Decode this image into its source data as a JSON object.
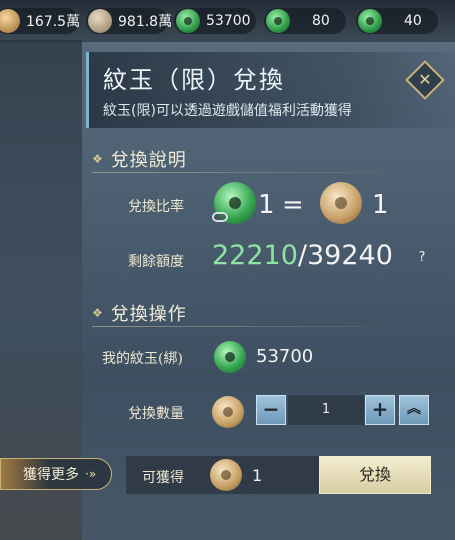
{
  "currencies": [
    {
      "icon": "gold-coin-icon",
      "value": "167.5萬"
    },
    {
      "icon": "silver-coin-icon",
      "value": "981.8萬"
    },
    {
      "icon": "jade-bound-icon",
      "value": "53700"
    },
    {
      "icon": "jade-add-icon",
      "value": "80"
    },
    {
      "icon": "jade-add-icon",
      "value": "40"
    }
  ],
  "header": {
    "title": "紋玉（限）兌換",
    "subtitle": "紋玉(限)可以透過遊戲儲值福利活動獲得"
  },
  "section_info": {
    "title": "兌換說明",
    "ratio_label": "兌換比率",
    "ratio_left": "1",
    "ratio_eq": "=",
    "ratio_right": "1",
    "remain_label": "剩餘額度",
    "remain_current": "22210",
    "remain_total": "/39240",
    "help": "?"
  },
  "section_op": {
    "title": "兌換操作",
    "my_jade_label": "我的紋玉(綁)",
    "my_jade_value": "53700",
    "qty_label": "兌換數量",
    "minus": "−",
    "qty_value": "1",
    "plus": "+",
    "max": "︽"
  },
  "footer": {
    "get_more": "獲得更多",
    "get_more_arrow": "·»",
    "obtain_label": "可獲得",
    "obtain_value": "1",
    "exchange_btn": "兌換"
  },
  "colors": {
    "accent_green": "#8fe3a0",
    "button_blue": "#8fb4cf",
    "confirm_cream": "#efe6c6"
  }
}
